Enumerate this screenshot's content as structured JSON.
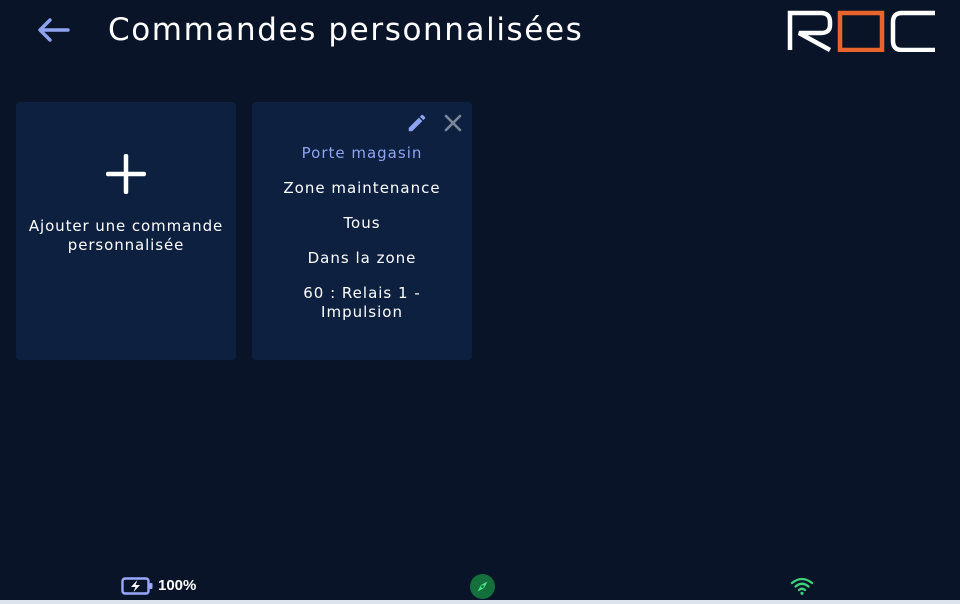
{
  "header": {
    "title": "Commandes personnalisées",
    "logo_text": "ROC",
    "back_icon": "arrow-left-icon"
  },
  "colors": {
    "background": "#0a1428",
    "card": "#0d2040",
    "accent": "#8fa4f0",
    "logo_orange": "#e8642c",
    "status_green": "#2fae5a"
  },
  "add_card": {
    "icon": "plus-icon",
    "label_line1": "Ajouter une commande",
    "label_line2": "personnalisée"
  },
  "command_card": {
    "name": "Porte magasin",
    "zone": "Zone maintenance",
    "who": "Tous",
    "where": "Dans la zone",
    "action_line1": "60 : Relais 1 -",
    "action_line2": "Impulsion",
    "edit_icon": "pencil-icon",
    "delete_icon": "close-icon"
  },
  "status_bar": {
    "battery_level": "100%",
    "battery_icon": "battery-charging-icon",
    "compass_icon": "compass-icon",
    "wifi_icon": "wifi-icon"
  }
}
